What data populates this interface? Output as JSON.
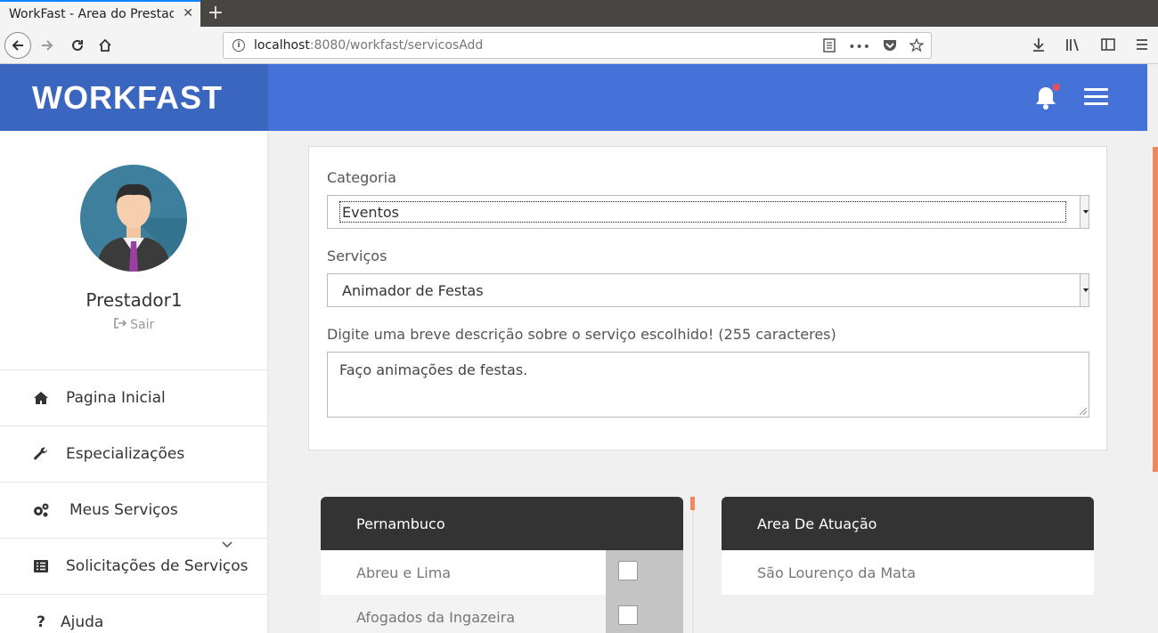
{
  "browser": {
    "tab_title": "WorkFast - Area do Prestador",
    "tab_close": "✕",
    "new_tab": "+",
    "url_host": "localhost",
    "url_rest": ":8080/workfast/servicosAdd"
  },
  "header": {
    "brand": "WORKFAST"
  },
  "sidebar": {
    "user_name": "Prestador1",
    "logout_label": "Sair",
    "items": [
      {
        "label": "Pagina Inicial",
        "icon": "home-icon"
      },
      {
        "label": "Especializações",
        "icon": "wrench-icon"
      },
      {
        "label": "Meus Serviços",
        "icon": "gears-icon"
      },
      {
        "label": "Solicitações de Serviços",
        "icon": "list-icon"
      },
      {
        "label": "Ajuda",
        "icon": "question-icon"
      }
    ]
  },
  "form": {
    "category_label": "Categoria",
    "category_value": "Eventos",
    "services_label": "Serviços",
    "services_value": "Animador de Festas",
    "description_label": "Digite uma breve descrição sobre o serviço escolhido! (255 caracteres)",
    "description_value": "Faço animações de festas."
  },
  "state_panel": {
    "title": "Pernambuco",
    "rows": [
      {
        "name": "Abreu e Lima",
        "checked": false
      },
      {
        "name": "Afogados da Ingazeira",
        "checked": false
      }
    ]
  },
  "area_panel": {
    "title": "Area De Atuação",
    "rows": [
      {
        "name": "São Lourenço da Mata"
      }
    ]
  },
  "colors": {
    "brand": "#3b66bf",
    "topbar": "#4472d6",
    "accent": "#f0885f",
    "panel_head": "#333333"
  }
}
